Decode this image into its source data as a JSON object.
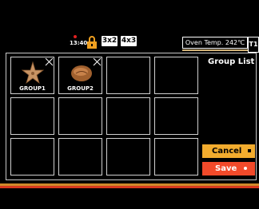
{
  "status_bar": {
    "time": "13:40",
    "mode_3x2": "3x2",
    "mode_4x3": "4x3",
    "oven_temp": "Oven Temp. 242℃",
    "tray": "T1"
  },
  "panel": {
    "title": "Group List",
    "cancel_label": "Cancel",
    "save_label": "Save"
  },
  "groups": [
    {
      "label": "GROUP1",
      "icon": "starfish-cookie-icon"
    },
    {
      "label": "GROUP2",
      "icon": "bread-roll-icon"
    }
  ],
  "colors": {
    "cancel": "#f2ac2e",
    "save": "#f24a2a",
    "lock": "#f0a020",
    "underline": "#d4b478"
  }
}
